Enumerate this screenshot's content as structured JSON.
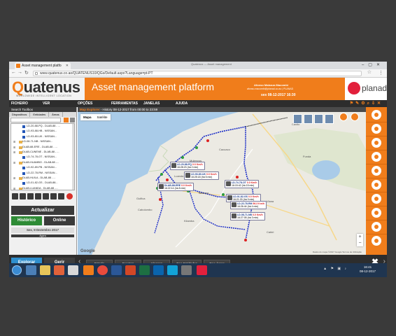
{
  "browser": {
    "tab_title": "Asset management platfo",
    "window_title": "Quatenus — Asset management",
    "url": "www.quatenus.co.ao/QUATENUS10/QGs/Default.aspx?Language=pt-PT"
  },
  "header": {
    "logo": "uatenus",
    "logo_q": "Q",
    "logo_sub": "WORLDWIDE INTELLIGENT LOCATION",
    "title": "Asset management platform",
    "user_name": "Afonso Malanza Macombi",
    "user_email": "afonso.macombi@planad.co.ao | PLANAD",
    "datetime": "sex 08-12-2017 16:30",
    "partner": "planad"
  },
  "menu": {
    "items": [
      "FICHEIRO",
      "VER",
      "OPÇÕES",
      "FERRAMENTAS",
      "JANELAS",
      "AJUDA"
    ]
  },
  "left_panel": {
    "title": "Search Toolbox",
    "tabs": [
      "Dispositivos",
      "Entidades",
      "Áreas"
    ],
    "tree": [
      "LD-20-88-PQ - DLAB-88 - ...",
      "LD-93-88-HB - NISSAN...",
      "LD-93-80-UK - NISSAN...",
      "LD-08-71-NB - NISSAN...",
      "DLAB-88-ERE - DLAB-88 - ...",
      "DLAB-CUNENE - DLAB-88 - ...",
      "LD-74-78-OT - NISSAN...",
      "DLAB-HUAMBO - DLAB-88 -...",
      "LD-92-89-PB - NISSAN...",
      "LD-22-78-RM - NISSAN...",
      "DLAB-HUILA - DLAB-88 - ...",
      "LD-01-82-GS - DLAB-88...",
      "DLAB-LUANDA - DLAB-88 -..."
    ],
    "update_label": "Actualizar",
    "history_label": "Histórico",
    "online_label": "Online",
    "date_label": "Sex, 8 Dezembro 2017",
    "date_sub": "Agora"
  },
  "map": {
    "header_title": "Map Explorer",
    "header_range": "- History 08-12-2017 from 00:00 to 23:59",
    "type_map": "Mapa",
    "type_sat": "Satélite",
    "place_labels": [
      "Cacuaco",
      "Mulenvos",
      "Luanda",
      "Talatona",
      "Gulfica",
      "Cabolombo",
      "Kilamba",
      "Viana",
      "Funda",
      "Cabiri",
      "Caxito"
    ],
    "popups": [
      {
        "plate": "LD-20-88-PQ",
        "speed": "0.0 Km/h",
        "time": "16:28:23 (há 2 min)"
      },
      {
        "plate": "LD-93-80-UK",
        "speed": "0.0 Km/h",
        "time": "16:25:18 (há 5 min)"
      },
      {
        "plate": "DLAB-88-ERE",
        "speed": "0.0 Km/h",
        "time": "16:22:14 (há 8 min)"
      },
      {
        "plate": "LD-74-78-OT",
        "speed": "0.0 Km/h",
        "time": "16:15:42 (há 15 min)"
      },
      {
        "plate": "LD-01-82-GS",
        "speed": "0.0 Km/h",
        "time": "16:21:33 (há 9 min)"
      },
      {
        "plate": "LD-22-78-RM",
        "speed": "56.3 Km/h",
        "time": "16:26:44 (há 4 min)"
      },
      {
        "plate": "LD-08-71-NB",
        "speed": "0.0 Km/h",
        "time": "16:27:05 (há 3 min)"
      }
    ],
    "copyright": "Dados do mapa ©2017 Google  Termos de Utilização",
    "google": "Google"
  },
  "bottom": {
    "explore_label": "Explorar",
    "manage_label": "Gerir",
    "tabs": [
      "Estado",
      "Eventos",
      "Viagens",
      "Geo Entidades",
      "Geo Áreas"
    ]
  },
  "taskbar": {
    "time": "16:41",
    "date": "08-12-2017"
  }
}
